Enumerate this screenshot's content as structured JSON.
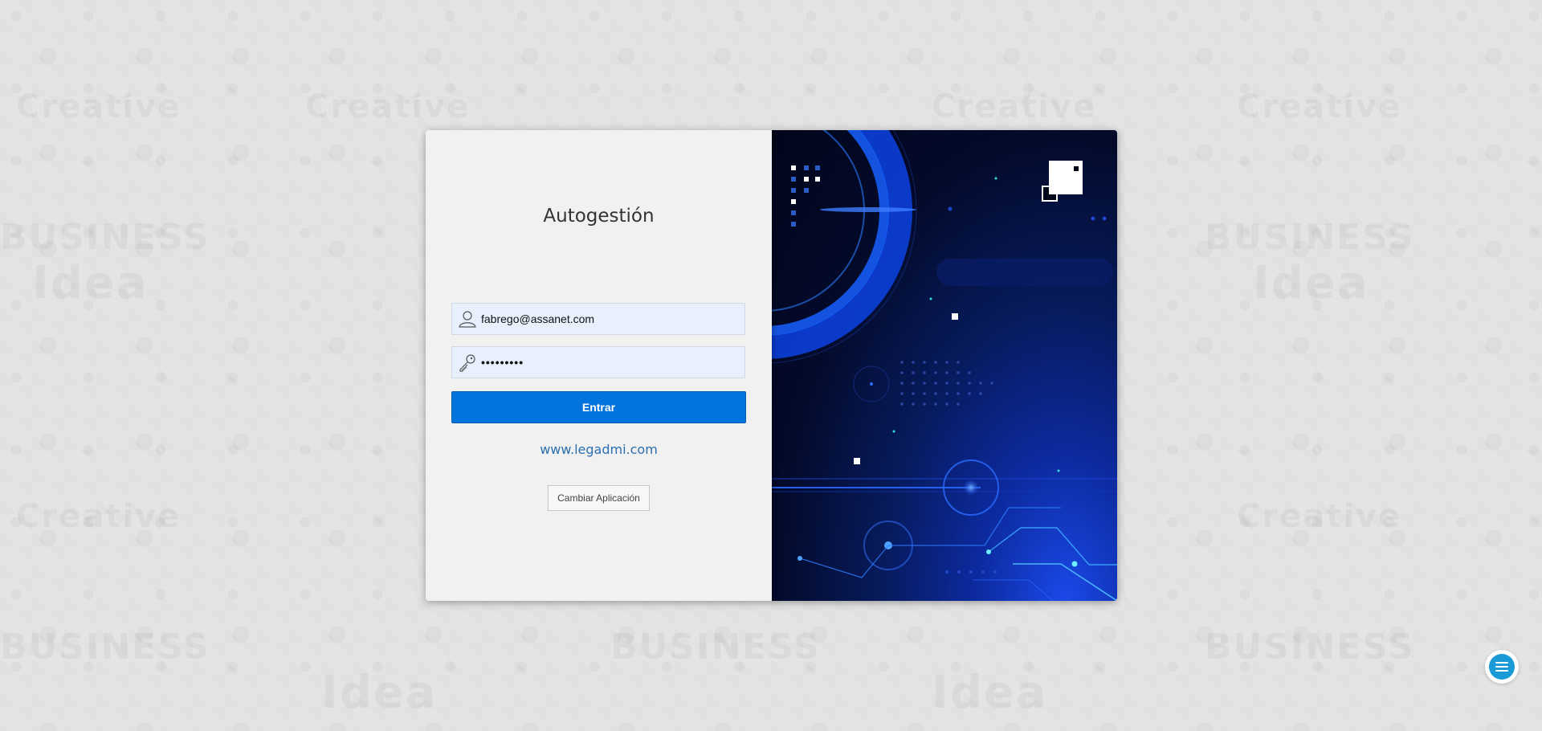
{
  "login": {
    "title": "Autogestión",
    "username_value": "fabrego@assanet.com",
    "password_value": "•••••••••",
    "submit_label": "Entrar",
    "website_link": "www.legadmi.com",
    "change_app_label": "Cambiar Aplicación"
  },
  "icons": {
    "username": "user-icon",
    "password": "key-icon",
    "brand": "square-logo-icon",
    "chat": "chat-menu-icon"
  },
  "colors": {
    "primary_button": "#0373dd",
    "link": "#2a6fb0",
    "chat_accent": "#1a9bd7",
    "hero_dark": "#02061b",
    "hero_blue": "#1b48e8"
  }
}
